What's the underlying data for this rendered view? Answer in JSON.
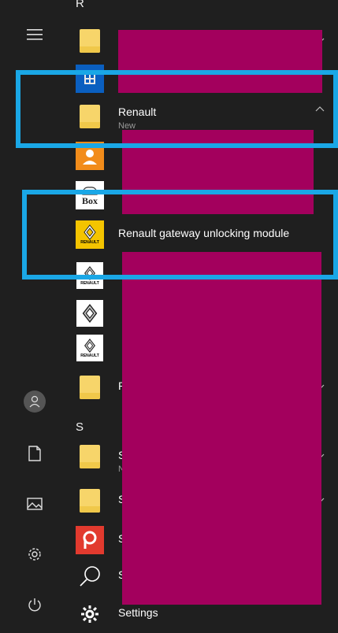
{
  "rail": {
    "items": [
      {
        "name": "hamburger-menu-icon"
      },
      {
        "name": "user-avatar-icon"
      },
      {
        "name": "documents-icon"
      },
      {
        "name": "pictures-icon"
      },
      {
        "name": "settings-gear-icon"
      },
      {
        "name": "power-icon"
      }
    ]
  },
  "section_letters": {
    "r": "R",
    "s": "S"
  },
  "apps": {
    "renault_folder": {
      "label": "Renault",
      "sub": "New"
    },
    "gateway_module": {
      "label": "Renault gateway unlocking module"
    },
    "r_folder_partial": {
      "label": "R"
    },
    "s_item_1": {
      "label": "S",
      "sub": "N"
    },
    "s_item_2": {
      "label": "S"
    },
    "s_item_3": {
      "label": "S"
    },
    "s_item_4": {
      "label": "S"
    },
    "settings": {
      "label": "Settings"
    },
    "box_tile": {
      "text": "Box"
    },
    "renault_tile_text": "RENAULT"
  },
  "colors": {
    "background": "#1f1f1f",
    "highlight": "#1aa7e6",
    "redaction": "#a3005d",
    "folder": "#f7d56a"
  }
}
